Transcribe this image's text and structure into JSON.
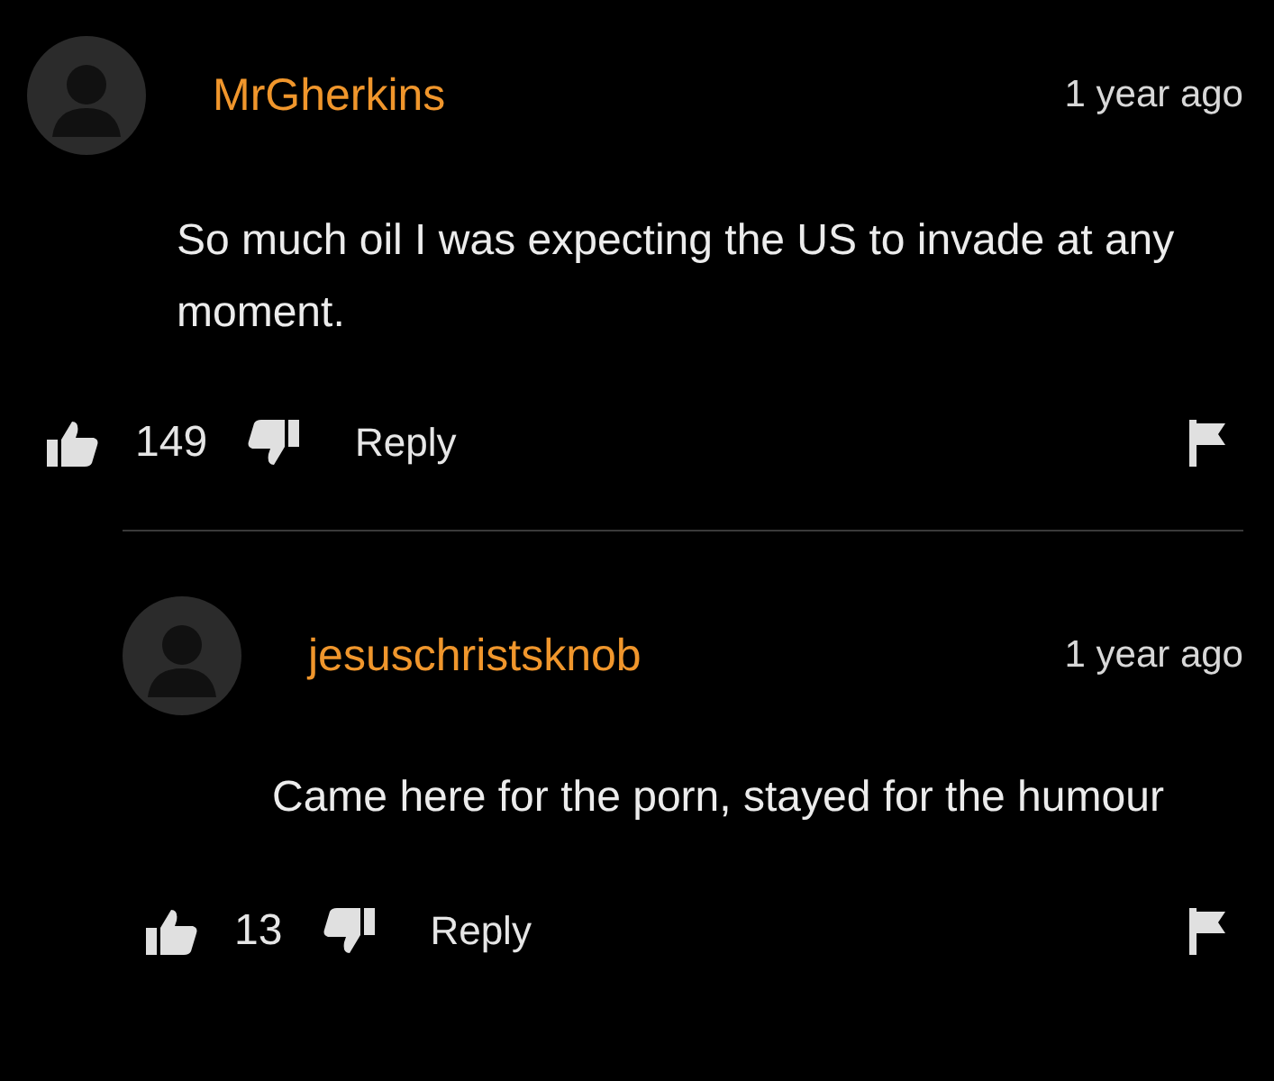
{
  "comments": [
    {
      "author": "MrGherkins",
      "time": "1 year ago",
      "text": "So much oil I was expecting the US to invade at any moment.",
      "likes": "149",
      "reply_label": "Reply",
      "replies": [
        {
          "author": "jesuschristsknob",
          "time": "1 year ago",
          "text": "Came here for the porn, stayed for the humour",
          "likes": "13",
          "reply_label": "Reply"
        }
      ]
    }
  ]
}
